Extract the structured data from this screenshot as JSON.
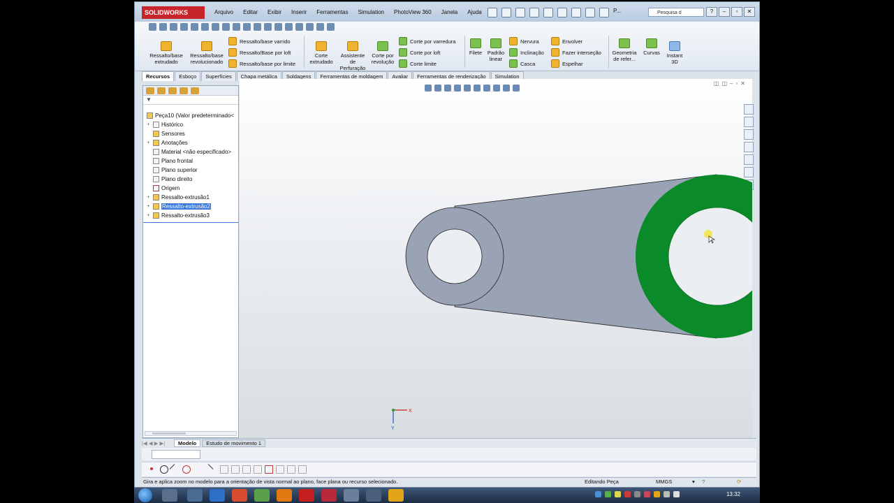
{
  "app": {
    "logo": "SOLIDWORKS",
    "menu": [
      "Arquivo",
      "Editar",
      "Exibir",
      "Inserir",
      "Ferramentas",
      "Simulation",
      "PhotoView 360",
      "Janela",
      "Ajuda"
    ],
    "search_placeholder": "Pesquisa d",
    "p_label": "P..."
  },
  "ribbon": {
    "big": [
      {
        "label1": "Ressalto/base",
        "label2": "extrudado"
      },
      {
        "label1": "Ressalto/base",
        "label2": "revolucionado"
      },
      {
        "label1": "Corte",
        "label2": "extrudado"
      },
      {
        "label1": "Assistente",
        "label2": "de",
        "label3": "Perfuração"
      },
      {
        "label1": "Corte por",
        "label2": "revolução"
      },
      {
        "label1": "Filete",
        "label2": ""
      },
      {
        "label1": "Padrão",
        "label2": "linear"
      },
      {
        "label1": "Geometria",
        "label2": "de refer..."
      },
      {
        "label1": "Curvas",
        "label2": ""
      },
      {
        "label1": "Instant",
        "label2": "3D"
      }
    ],
    "small": [
      "Ressalto/base varrido",
      "Ressalto/Base por loft",
      "Ressalto/base por limite",
      "Corte por varredura",
      "Corte por loft",
      "Corte limite",
      "Nervura",
      "Inclinação",
      "Casca",
      "Envolver",
      "Fazer interseção",
      "Espelhar"
    ]
  },
  "tabs": [
    "Recursos",
    "Esboço",
    "Superfícies",
    "Chapa metálica",
    "Soldagens",
    "Ferramentas de moldagem",
    "Avaliar",
    "Ferramentas de renderização",
    "Simulation"
  ],
  "active_tab": "Recursos",
  "tree": {
    "root": "Peça10  (Valor predeterminado<",
    "items": [
      {
        "label": "Histórico",
        "expandable": true
      },
      {
        "label": "Sensores",
        "expandable": false
      },
      {
        "label": "Anotações",
        "expandable": true
      },
      {
        "label": "Material <não especificado>",
        "expandable": false
      },
      {
        "label": "Plano frontal",
        "expandable": false
      },
      {
        "label": "Plano superior",
        "expandable": false
      },
      {
        "label": "Plano direito",
        "expandable": false
      },
      {
        "label": "Origem",
        "expandable": false
      },
      {
        "label": "Ressalto-extrusão1",
        "expandable": true
      },
      {
        "label": "Ressalto-extrusão2",
        "expandable": true,
        "selected": true
      },
      {
        "label": "Ressalto-extrusão3",
        "expandable": true
      }
    ]
  },
  "triad": {
    "x": "X",
    "y": "Y"
  },
  "bottom_tabs": [
    "Modelo",
    "Estudo de movimento 1"
  ],
  "status": {
    "message": "Gira e aplica zoom no modelo para a orientação de vista normal ao plano, face plana ou recurso selecionado.",
    "mode": "Editando Peça",
    "units": "MMGS"
  },
  "clock": "13:32",
  "colors": {
    "selected_face": "#0b8a2a",
    "part": "#9aa3b5",
    "highlight": "#3b78d8"
  }
}
